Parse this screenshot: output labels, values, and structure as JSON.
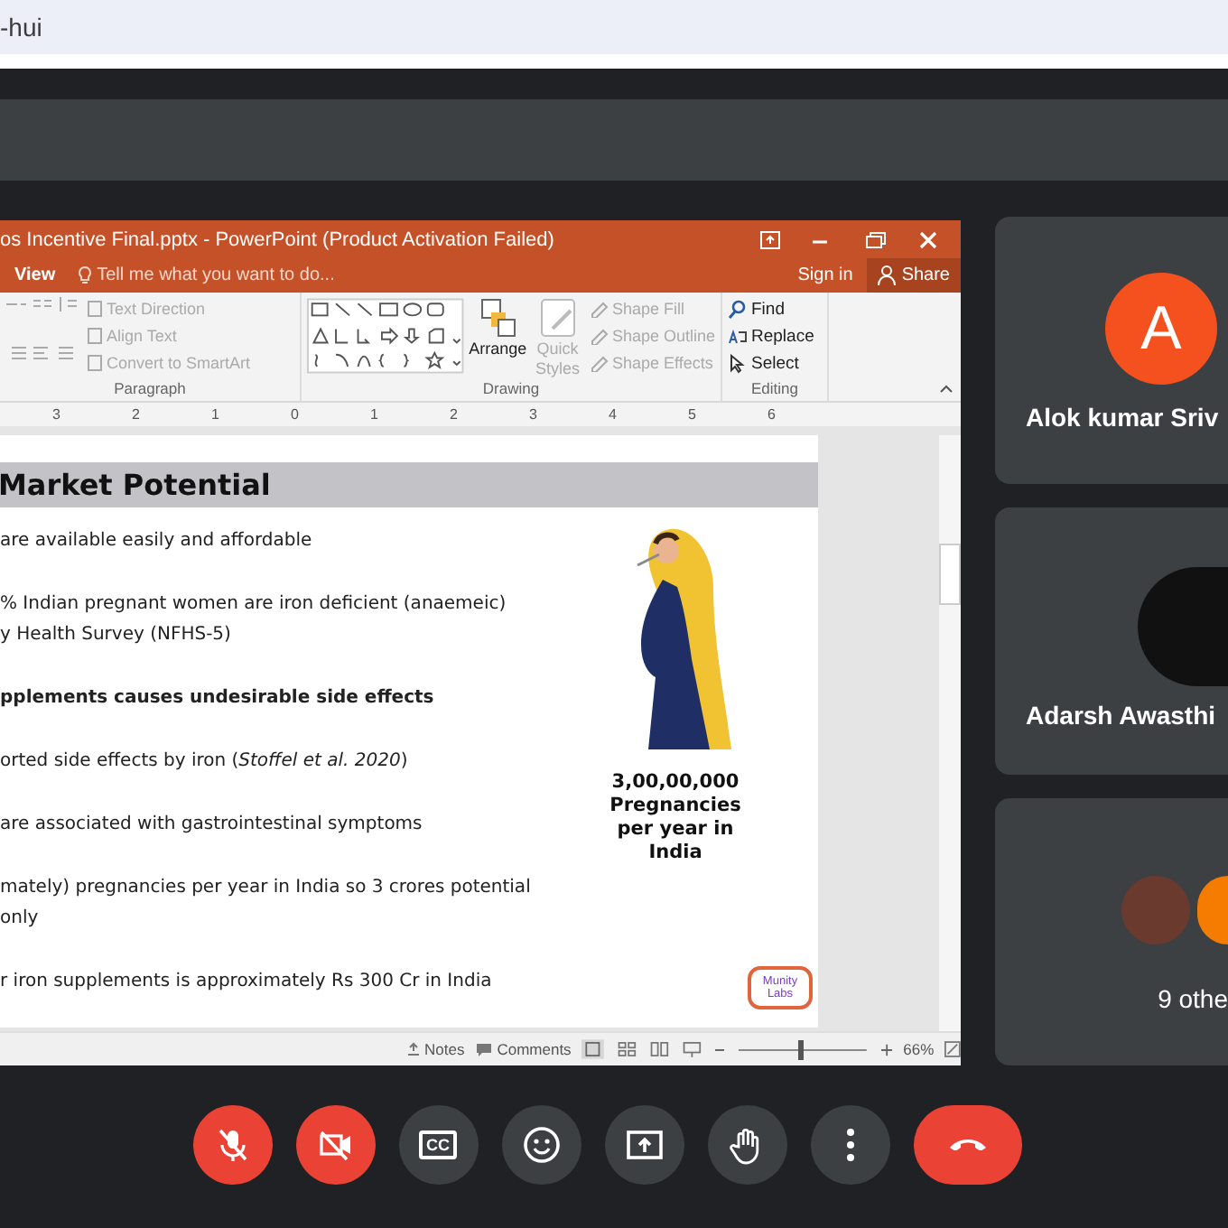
{
  "browser": {
    "tab_text": "-hui"
  },
  "presentation": {
    "title": "os Incentive Final.pptx - PowerPoint (Product Activation Failed)",
    "menu_tab": "View",
    "tell_me": "Tell me what you want to do...",
    "sign_in": "Sign in",
    "share": "Share",
    "paragraph_group": {
      "label": "Paragraph",
      "items": [
        {
          "label": "Text Direction",
          "disabled": true
        },
        {
          "label": "Align Text",
          "disabled": true
        },
        {
          "label": "Convert to SmartArt",
          "disabled": true
        }
      ]
    },
    "drawing_group": {
      "label": "Drawing",
      "arrange": {
        "label": "Arrange",
        "disabled": false
      },
      "quick_styles": {
        "label": "Quick Styles",
        "disabled": true
      },
      "items": [
        {
          "label": "Shape Fill",
          "disabled": true
        },
        {
          "label": "Shape Outline",
          "disabled": true
        },
        {
          "label": "Shape Effects",
          "disabled": true
        }
      ]
    },
    "editing_group": {
      "label": "Editing",
      "items": [
        {
          "kind": "find",
          "label": "Find",
          "disabled": false
        },
        {
          "kind": "replace",
          "label": "Replace",
          "disabled": false
        },
        {
          "kind": "select",
          "label": "Select",
          "disabled": false
        }
      ]
    },
    "ruler": [
      "3",
      "2",
      "1",
      "0",
      "1",
      "2",
      "3",
      "4",
      "5",
      "6"
    ],
    "slide": {
      "title": "Market Potential",
      "paragraphs": [
        {
          "kind": "normal",
          "lines": [
            "are available easily and affordable"
          ]
        },
        {
          "kind": "normal",
          "lines": [
            "% Indian pregnant women are iron deficient (anaemeic)",
            "y Health Survey (NFHS-5)"
          ]
        },
        {
          "kind": "bold",
          "lines": [
            "pplements causes undesirable side effects"
          ]
        },
        {
          "kind": "normal",
          "lines": [
            "orted side effects by iron (*Stoffel et al. 2020*)"
          ]
        },
        {
          "kind": "normal",
          "lines": [
            "are associated with gastrointestinal symptoms"
          ]
        },
        {
          "kind": "normal",
          "lines": [
            "mately) pregnancies per year in India so 3 crores potential",
            "only"
          ]
        },
        {
          "kind": "normal",
          "lines": [
            "r iron supplements is approximately Rs 300 Cr in India"
          ]
        }
      ],
      "stat": "3,00,00,000 Pregnancies per year in India",
      "logo": "Munity Labs"
    },
    "status_bar": {
      "notes": "Notes",
      "comments": "Comments",
      "zoom": "66%",
      "level": 0.47
    }
  },
  "participants": [
    {
      "name": "Alok kumar Sriv",
      "kind": "letter",
      "letter": "A",
      "color": "#f4511e"
    },
    {
      "name": "Adarsh Awasthi",
      "kind": "photo"
    },
    {
      "name": "9 othe",
      "kind": "group",
      "color": "#f57c00"
    }
  ],
  "controls": [
    {
      "kind": "mic",
      "on": false
    },
    {
      "kind": "camera",
      "on": false
    },
    {
      "kind": "captions",
      "label": "CC"
    },
    {
      "kind": "emoji"
    },
    {
      "kind": "present"
    },
    {
      "kind": "hand"
    },
    {
      "kind": "more"
    },
    {
      "kind": "hangup"
    }
  ]
}
